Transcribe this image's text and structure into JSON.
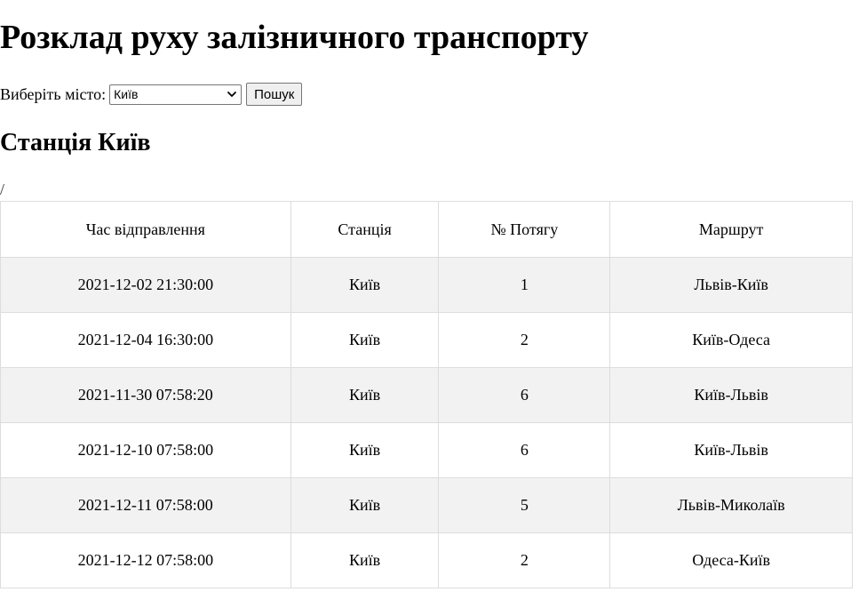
{
  "page": {
    "title": "Розклад руху залізничного транспорту"
  },
  "search": {
    "label": "Виберіть місто:",
    "selected_city": "Київ",
    "button_label": "Пошук"
  },
  "station": {
    "heading": "Станція Київ",
    "path_text": "/"
  },
  "table": {
    "headers": [
      "Час відправлення",
      "Станція",
      "№ Потягу",
      "Маршрут"
    ],
    "rows": [
      [
        "2021-12-02 21:30:00",
        "Київ",
        "1",
        "Львів-Київ"
      ],
      [
        "2021-12-04 16:30:00",
        "Київ",
        "2",
        "Київ-Одеса"
      ],
      [
        "2021-11-30 07:58:20",
        "Київ",
        "6",
        "Київ-Львів"
      ],
      [
        "2021-12-10 07:58:00",
        "Київ",
        "6",
        "Київ-Львів"
      ],
      [
        "2021-12-11 07:58:00",
        "Київ",
        "5",
        "Львів-Миколаїв"
      ],
      [
        "2021-12-12 07:58:00",
        "Київ",
        "2",
        "Одеса-Київ"
      ]
    ]
  },
  "icons": {
    "select_chevron": "chevron-down-icon"
  }
}
